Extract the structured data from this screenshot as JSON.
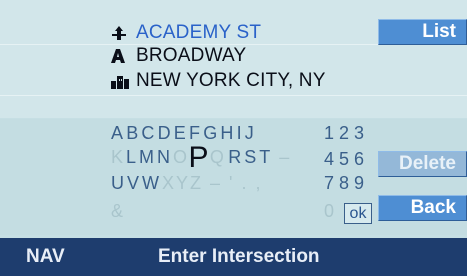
{
  "address_lines": [
    {
      "icon": "street-sign-icon",
      "text": "ACADEMY ST",
      "state": "active"
    },
    {
      "icon": "street-letter-icon",
      "text": "BROADWAY",
      "state": "normal"
    },
    {
      "icon": "city-icon",
      "text": "NEW YORK CITY, NY",
      "state": "normal"
    }
  ],
  "keyboard": {
    "row1": {
      "enabled": "ABCDEFGHIJ",
      "numbers": "123"
    },
    "row2": {
      "disabled_lead": "K",
      "enabled_a": "LMN",
      "disabled_a": "O",
      "current": "P",
      "disabled_b": "Q",
      "enabled_b": "RST",
      "disabled_c": "–",
      "numbers": "456"
    },
    "row3": {
      "enabled": "UVW",
      "disabled": "XYZ – ' . ,",
      "numbers": "789"
    },
    "row4": {
      "disabled": "&",
      "zero": "0",
      "ok_label": "ok"
    }
  },
  "buttons": {
    "list_label": "List",
    "delete_label": "Delete",
    "back_label": "Back"
  },
  "status": {
    "mode": "NAV",
    "title": "Enter Intersection"
  },
  "colors": {
    "accent_blue": "#4e8ed3",
    "active_text": "#2a62c9",
    "status_bar": "#1e3d6e"
  }
}
